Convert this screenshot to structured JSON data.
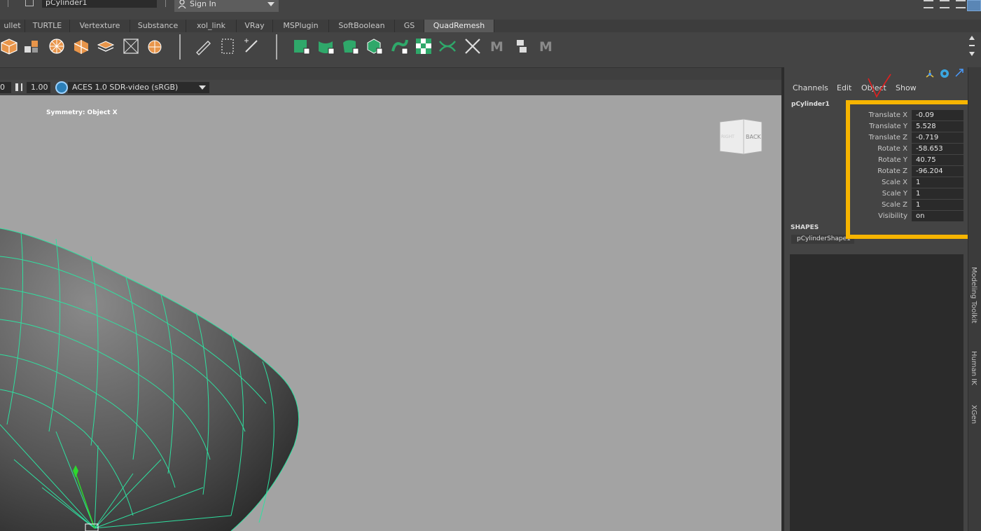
{
  "topbar": {
    "object_field": "pCylinder1",
    "signin_label": "Sign In"
  },
  "shelf_tabs": [
    "ullet",
    "TURTLE",
    "Vertexture",
    "Substance",
    "xol_link",
    "VRay",
    "MSPlugin",
    "SoftBoolean",
    "GS",
    "QuadRemesh"
  ],
  "shelf_tab_active": "QuadRemesh",
  "viewport": {
    "field_left": "0",
    "gamma_value": "1.00",
    "colorspace": "ACES 1.0 SDR-video (sRGB)",
    "symmetry_label": "Symmetry: Object X",
    "viewcube_right": "RIGHT",
    "viewcube_back": "BACK"
  },
  "channel_box": {
    "menu": [
      "Channels",
      "Edit",
      "Object",
      "Show"
    ],
    "object_name": "pCylinder1",
    "channels": [
      {
        "label": "Translate X",
        "value": "-0.09"
      },
      {
        "label": "Translate Y",
        "value": "5.528"
      },
      {
        "label": "Translate Z",
        "value": "-0.719"
      },
      {
        "label": "Rotate X",
        "value": "-58.653"
      },
      {
        "label": "Rotate Y",
        "value": "40.75"
      },
      {
        "label": "Rotate Z",
        "value": "-96.204"
      },
      {
        "label": "Scale X",
        "value": "1"
      },
      {
        "label": "Scale Y",
        "value": "1"
      },
      {
        "label": "Scale Z",
        "value": "1"
      },
      {
        "label": "Visibility",
        "value": "on"
      }
    ],
    "shapes_header": "SHAPES",
    "shape_item": "pCylinderShape1"
  },
  "side_tabs": [
    "Modeling Toolkit",
    "Human IK",
    "XGen"
  ],
  "colors": {
    "highlight": "#f7b500",
    "wireframe": "#2fe0a0",
    "annotation": "#e02020"
  }
}
